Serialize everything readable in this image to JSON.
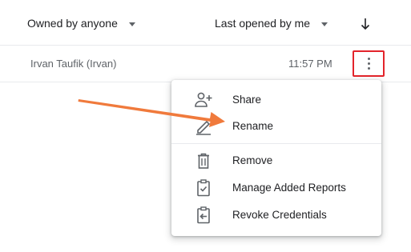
{
  "header": {
    "owner_filter_label": "Owned by anyone",
    "sort_label": "Last opened by me",
    "sort_direction_icon": "arrow-down-icon"
  },
  "row": {
    "owner": "Irvan Taufik (Irvan)",
    "time": "11:57 PM"
  },
  "menu": {
    "items": [
      {
        "label": "Share",
        "icon": "person-add-icon"
      },
      {
        "label": "Rename",
        "icon": "pencil-icon"
      },
      {
        "label": "Remove",
        "icon": "trash-icon"
      },
      {
        "label": "Manage Added Reports",
        "icon": "clipboard-check-icon"
      },
      {
        "label": "Revoke Credentials",
        "icon": "clipboard-revoke-icon"
      }
    ]
  },
  "colors": {
    "highlight_border": "#e3242b",
    "annotation_arrow": "#f07a3c"
  }
}
